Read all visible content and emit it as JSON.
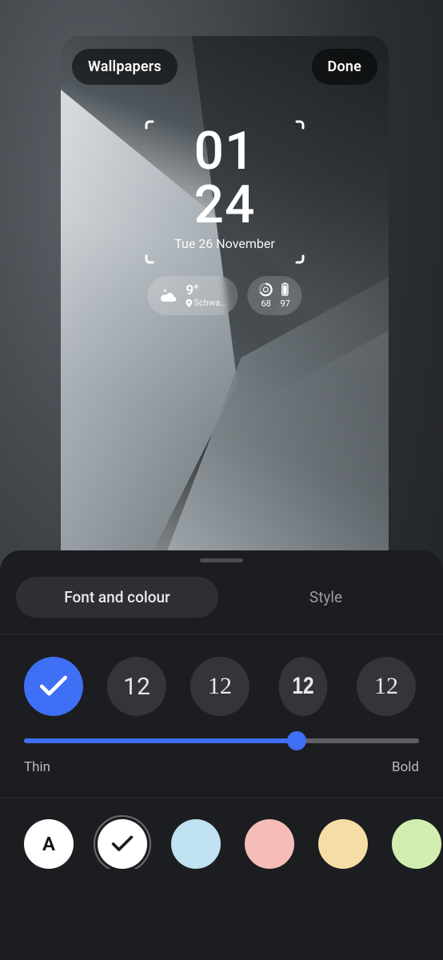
{
  "preview": {
    "wallpapers_btn": "Wallpapers",
    "done_btn": "Done",
    "clock": {
      "hours": "01",
      "minutes": "24",
      "date": "Tue 26 November"
    },
    "weather": {
      "temp": "9°",
      "location": "Schwa..."
    },
    "battery": {
      "watch_pct": "68",
      "phone_pct": "97"
    }
  },
  "sheet": {
    "tabs": {
      "font_colour": "Font and colour",
      "style": "Style",
      "active": "font_colour"
    },
    "font_options": {
      "sample": "12",
      "selected_index": 0
    },
    "slider": {
      "min_label": "Thin",
      "max_label": "Bold",
      "value_pct": 69
    },
    "colours": {
      "auto_label": "A",
      "items": [
        {
          "id": "auto",
          "bg": "#ffffff"
        },
        {
          "id": "white",
          "bg": "#ffffff",
          "selected": true
        },
        {
          "id": "blue",
          "bg": "#bfe1f1"
        },
        {
          "id": "pink",
          "bg": "#f5bcb8"
        },
        {
          "id": "peach",
          "bg": "#f6dca6"
        },
        {
          "id": "green",
          "bg": "#d1eeb0"
        },
        {
          "id": "rainbow",
          "bg": "linear-gradient(135deg,#f6c6a2,#e9b7d4,#b9d6f4,#c9efc0)"
        }
      ]
    }
  },
  "colors": {
    "accent": "#3e6ff4",
    "sheet_bg": "#1c1d20"
  }
}
